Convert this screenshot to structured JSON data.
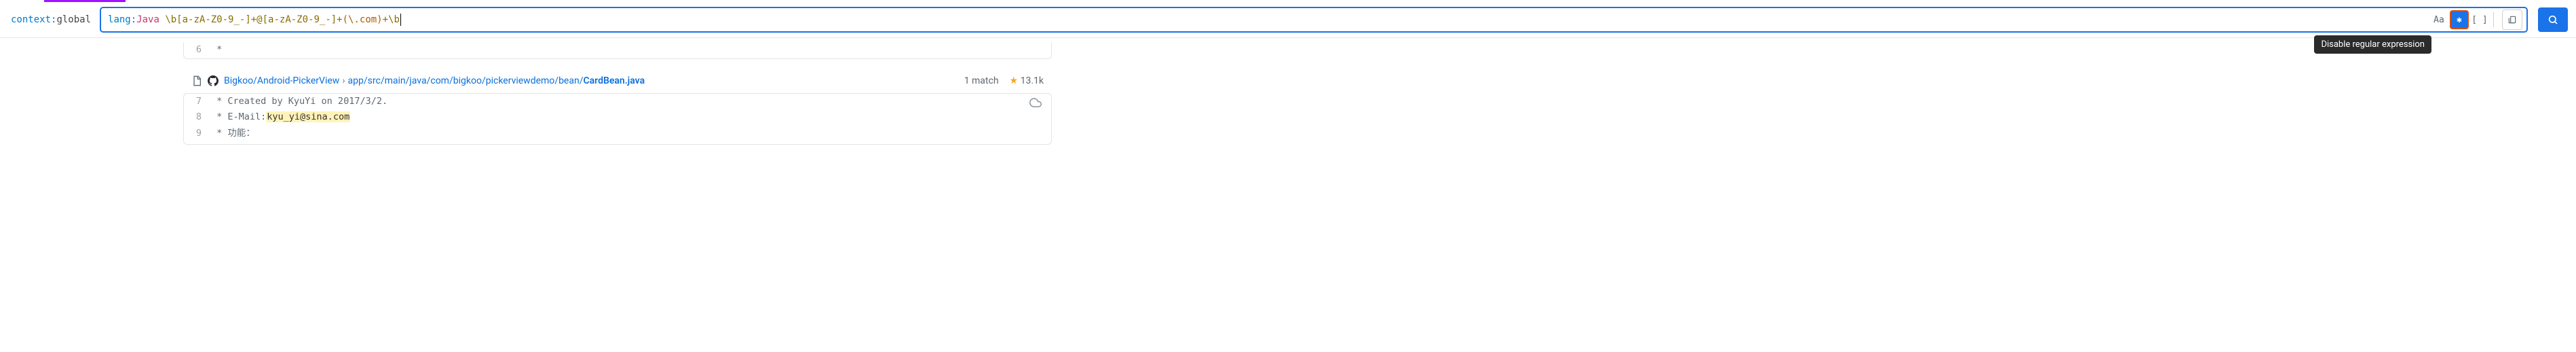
{
  "searchBar": {
    "context": {
      "key": "context:",
      "value": "global"
    },
    "query": {
      "filterKey": "lang:",
      "filterVal": "Java",
      "regexParts": [
        " \\b[a-zA-Z0-9_-]+@[a-zA-Z0-9_-]+",
        "(\\.com)",
        "+\\b"
      ]
    },
    "controls": {
      "caseSensitive": "Aa",
      "regexActive": "✱",
      "structural": "[ ]"
    },
    "tooltip": "Disable regular expression"
  },
  "results": [
    {
      "type": "codeonly",
      "lines": [
        {
          "num": "6",
          "text": " *"
        }
      ]
    },
    {
      "type": "file",
      "repo": "Bigkoo/Android-PickerView",
      "pathParts": [
        "app",
        "src",
        "main",
        "java",
        "com",
        "bigkoo",
        "pickerviewdemo",
        "bean"
      ],
      "fileName": "CardBean.java",
      "matchCount": "1 match",
      "stars": "13.1k",
      "lines": [
        {
          "num": "7",
          "pre": " * Created by KyuYi on 2017/3/2.",
          "hl": "",
          "post": ""
        },
        {
          "num": "8",
          "pre": " * E-Mail:",
          "hl": "kyu_yi@sina.com",
          "post": ""
        },
        {
          "num": "9",
          "pre": " * 功能：",
          "hl": "",
          "post": ""
        }
      ]
    }
  ]
}
